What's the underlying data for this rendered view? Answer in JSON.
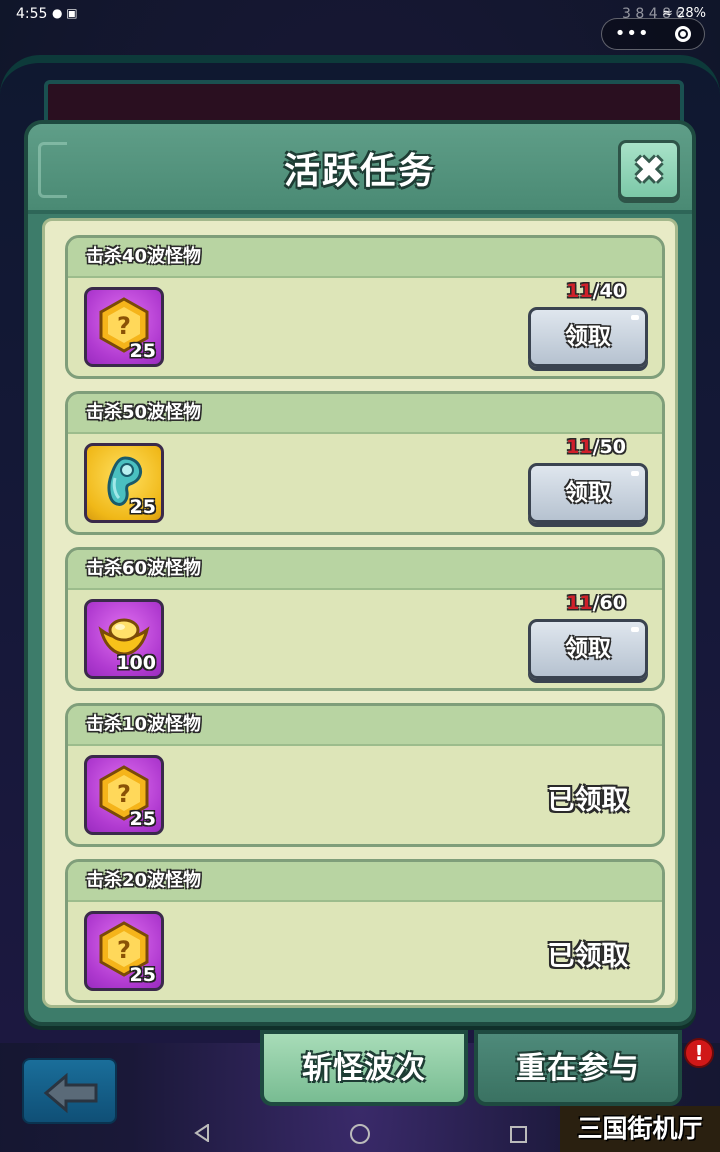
{
  "status_bar": {
    "time": "4:55",
    "battery": "28%"
  },
  "background": {
    "overlay_text": "3 8 4 8 6"
  },
  "dialog": {
    "title": "活跃任务",
    "tasks": [
      {
        "title": "击杀40波怪物",
        "reward_icon": "mystery-hexagon-icon",
        "reward_qty": "25",
        "progress_current": "11",
        "progress_total": "/40",
        "action_label": "领取",
        "claimed": false
      },
      {
        "title": "击杀50波怪物",
        "reward_icon": "jade-magatama-icon",
        "reward_qty": "25",
        "progress_current": "11",
        "progress_total": "/50",
        "action_label": "领取",
        "claimed": false
      },
      {
        "title": "击杀60波怪物",
        "reward_icon": "gold-ingot-icon",
        "reward_qty": "100",
        "progress_current": "11",
        "progress_total": "/60",
        "action_label": "领取",
        "claimed": false
      },
      {
        "title": "击杀10波怪物",
        "reward_icon": "mystery-hexagon-icon",
        "reward_qty": "25",
        "status_label": "已领取",
        "claimed": true
      },
      {
        "title": "击杀20波怪物",
        "reward_icon": "mystery-hexagon-icon",
        "reward_qty": "25",
        "status_label": "已领取",
        "claimed": true
      }
    ]
  },
  "bottom_tabs": {
    "active": "斩怪波次",
    "inactive": "重在参与"
  },
  "badge": {
    "alert": "!"
  },
  "watermark": "三国街机厅",
  "colors": {
    "dialog_green": "#3d7c6a",
    "panel": "#e8ebc6",
    "progress_red": "#d0202a",
    "reward_purple": "#b03ad0",
    "reward_gold": "#f0b818"
  }
}
